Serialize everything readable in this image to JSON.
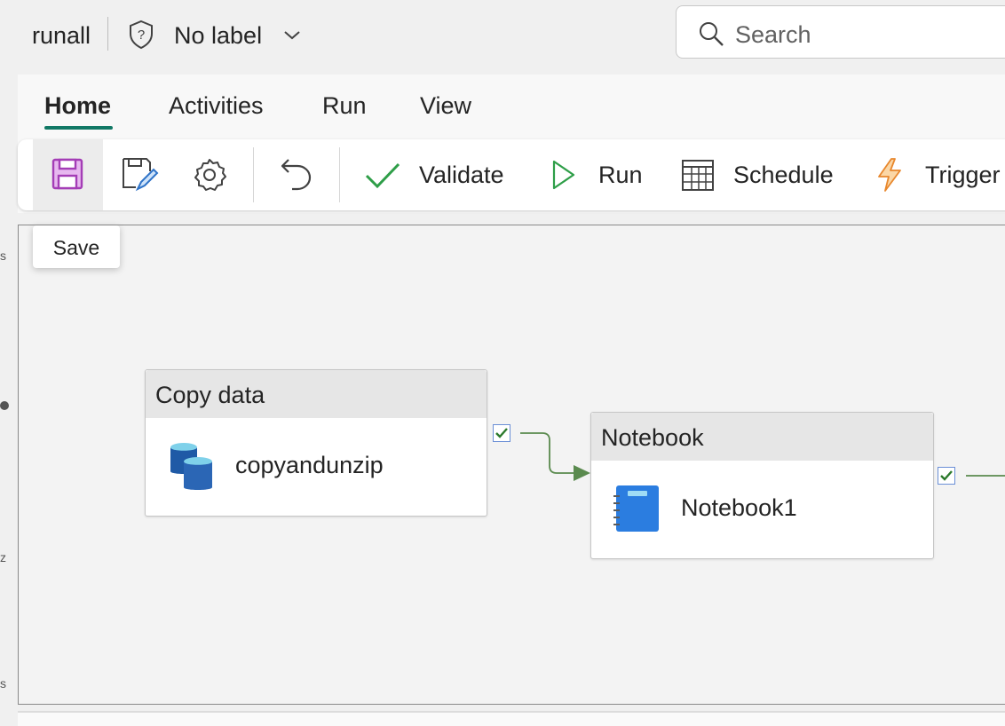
{
  "header": {
    "title": "runall",
    "sensitivity_label": "No label",
    "search": {
      "placeholder": "Search"
    }
  },
  "ribbon": {
    "tabs": [
      {
        "label": "Home",
        "active": true
      },
      {
        "label": "Activities"
      },
      {
        "label": "Run"
      },
      {
        "label": "View"
      }
    ],
    "toolbar": {
      "validate_label": "Validate",
      "run_label": "Run",
      "schedule_label": "Schedule",
      "trigger_label": "Trigger"
    },
    "tooltip": "Save"
  },
  "canvas": {
    "activities": [
      {
        "type": "Copy data",
        "name": "copyandunzip"
      },
      {
        "type": "Notebook",
        "name": "Notebook1"
      }
    ]
  },
  "colors": {
    "accent": "#117865",
    "save_icon": "#a43db6",
    "connector": "#5a8a4e",
    "validate_check": "#2e9e48",
    "trigger_bolt": "#f2a33a"
  }
}
